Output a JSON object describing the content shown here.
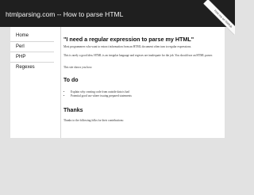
{
  "header": {
    "title": "htmlparsing.com -- How to parse HTML",
    "ribbon": "Fork me on GitHub"
  },
  "sidebar": {
    "items": [
      {
        "label": "Home"
      },
      {
        "label": "Perl"
      },
      {
        "label": "PHP"
      },
      {
        "label": "Regexes"
      }
    ]
  },
  "main": {
    "heading": "\"I need a regular expression to parse my HTML\"",
    "p1": "Most programmers who want to extract information from an HTML document often turn to regular expressions.",
    "p2": "This is rarely a good idea. HTML is an irregular language and regexes are inadequate for the job. You should use an HTML parser.",
    "p3": "This site shows you how.",
    "todo_heading": "To do",
    "todo_items": [
      "Explain why creating code from outside data is bad",
      "Potential good use where issuing prepared statements"
    ],
    "thanks_heading": "Thanks",
    "thanks_text": "Thanks to the following folks for their contributions:"
  }
}
